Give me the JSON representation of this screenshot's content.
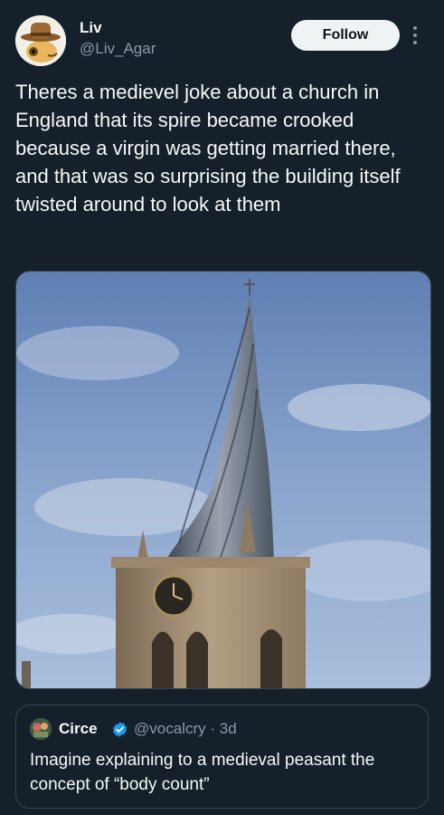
{
  "author": {
    "display_name": "Liv",
    "handle": "@Liv_Agar",
    "avatar_icon": "gecko-with-cowboy-hat-avatar"
  },
  "actions": {
    "follow_label": "Follow",
    "more_icon": "vertical-ellipsis-icon"
  },
  "tweet": {
    "text": "Theres a medievel joke about a church in England that its spire became crooked because a virgin was getting married there, and that was so surprising the building itself twisted around to look at them"
  },
  "media": {
    "subject": "crooked-church-spire-photo"
  },
  "quoted_tweet": {
    "display_name": "Circe",
    "handle": "@vocalcry",
    "separator": "·",
    "time": "3d",
    "verified_icon": "verified-badge-icon",
    "text": "Imagine explaining to a medieval peasant the concept of “body count”"
  },
  "colors": {
    "background": "#15202b",
    "text_primary": "#f7f9f9",
    "text_secondary": "#8b98a5",
    "border": "#38444d",
    "verified": "#1d9bf0"
  }
}
